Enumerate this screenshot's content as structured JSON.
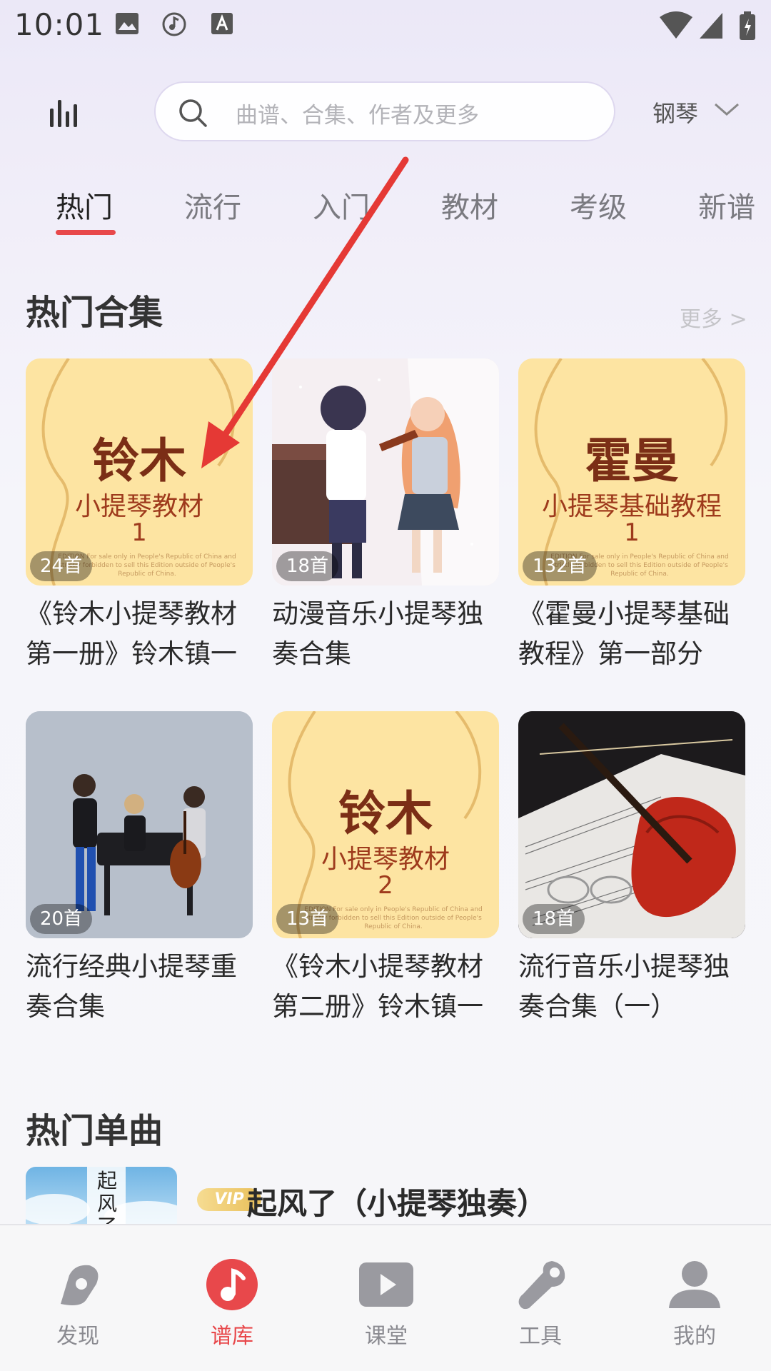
{
  "status_bar": {
    "time": "10:01"
  },
  "header": {
    "search_placeholder": "曲谱、合集、作者及更多",
    "instrument": "钢琴"
  },
  "tabs": [
    {
      "label": "热门"
    },
    {
      "label": "流行"
    },
    {
      "label": "入门"
    },
    {
      "label": "教材"
    },
    {
      "label": "考级"
    },
    {
      "label": "新谱"
    }
  ],
  "hot_collections": {
    "title": "热门合集",
    "more": "更多 >",
    "items": [
      {
        "count": "24首",
        "title": "《铃木小提琴教材第一册》铃木镇一",
        "cover": {
          "title": "铃木",
          "subtitle": "小提琴教材",
          "volume": "1"
        }
      },
      {
        "count": "18首",
        "title": "动漫音乐小提琴独奏合集"
      },
      {
        "count": "132首",
        "title": "《霍曼小提琴基础教程》第一部分",
        "cover": {
          "title": "霍曼",
          "subtitle": "小提琴基础教程",
          "volume": "1"
        }
      },
      {
        "count": "20首",
        "title": "流行经典小提琴重奏合集"
      },
      {
        "count": "13首",
        "title": "《铃木小提琴教材第二册》铃木镇一",
        "cover": {
          "title": "铃木",
          "subtitle": "小提琴教材",
          "volume": "2"
        }
      },
      {
        "count": "18首",
        "title": "流行音乐小提琴独奏合集（一）"
      }
    ],
    "cover_fine_print": "EDITION For sale only in People's Republic of China and strictly forbidden to sell this Edition outside of People's Republic of China."
  },
  "hot_singles": {
    "title": "热门单曲",
    "items": [
      {
        "vip": "VIP",
        "title": "起风了（小提琴独奏）",
        "thumb_text": "起风了"
      }
    ]
  },
  "bottom_nav": [
    {
      "label": "发现",
      "icon": "discover-icon"
    },
    {
      "label": "谱库",
      "icon": "music-note-icon",
      "active": true
    },
    {
      "label": "课堂",
      "icon": "play-video-icon"
    },
    {
      "label": "工具",
      "icon": "wrench-icon"
    },
    {
      "label": "我的",
      "icon": "person-icon"
    }
  ],
  "colors": {
    "accent": "#e8484b",
    "annotation": "#e53935",
    "book_cover": "#fde4a2"
  }
}
